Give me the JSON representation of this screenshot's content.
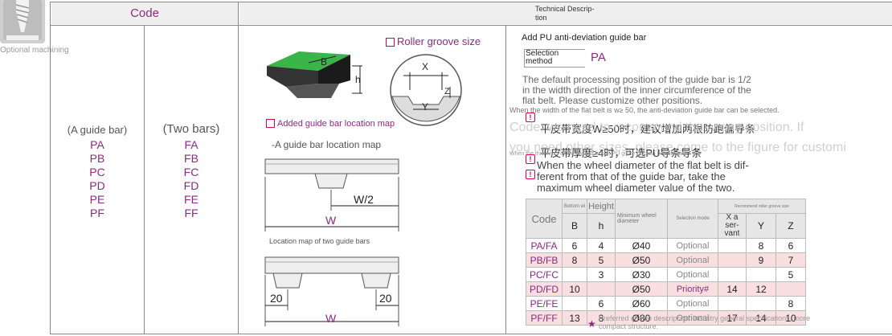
{
  "sidebar": {
    "label": "Optional machining"
  },
  "header": {
    "code": "Code",
    "tech_line1": "Technical Descrip-",
    "tech_line2": "tion"
  },
  "col_a": {
    "title": "(A guide bar)",
    "codes": [
      "PA",
      "PB",
      "PC",
      "PD",
      "PE",
      "PF"
    ]
  },
  "col_b": {
    "title": "(Two bars)",
    "codes": [
      "FA",
      "FB",
      "FC",
      "FD",
      "FE",
      "FF"
    ]
  },
  "diagrams": {
    "roller_groove": "Roller groove size",
    "added_map": "Added guide bar location map",
    "single_map": "-A guide bar location map",
    "two_map": "Location map of two guide bars",
    "dim_B": "B",
    "dim_h": "h",
    "dim_X": "X",
    "dim_Y": "Y",
    "dim_Z": "Z",
    "dim_W2": "W/2",
    "dim_W": "W",
    "dim_20": "20"
  },
  "tech": {
    "add_title": "Add PU anti-deviation guide bar",
    "sel_line1": "Selection",
    "sel_line2": "method",
    "sel_value": "PA",
    "para1_l1": "The default processing position of the guide bar is 1/2",
    "para1_l2": "in the width direction of the inner circumference of the",
    "para1_l3": "flat belt. Please customize other positions.",
    "note_small1": "When the width of the flat belt is w≥ 50, the anti-deviation guide bar can be selected.",
    "note_cn1": "平皮带宽度W≥50时，建议增加两根防跑偏导条",
    "overlay1": "Code, we need to recommend the wrong position. If",
    "overlay2": "you need other sizes, please come to the figure for customi",
    "note_cn2": "平皮带厚度≥4时，可选PU导条导条",
    "note_small2": "When the thickness of the flat belt is ≥ 4, PU guide bar can be selected.",
    "wheel_l1": "When the wheel diameter of the flat belt is dif-",
    "wheel_l2": "ferent from that of the guide bar, take the",
    "wheel_l3": "maximum wheel diameter value of the two.",
    "footer_l1": "Preferred choice description: industry general specifications, more",
    "footer_l2": "compact structure.",
    "star": "★",
    "warn_icon": "!"
  },
  "spec_table": {
    "h_code": "Code",
    "h_bottom": "Bottom wi",
    "h_height": "Height",
    "h_minwheel_l1": "Minimum wheel",
    "h_minwheel_l2": "diameter",
    "h_selection": "Selection mode",
    "h_groove": "Recommend roller groove size",
    "h_B": "B",
    "h_h": "h",
    "h_X": "X a ser- vant",
    "h_Y": "Y",
    "h_Z": "Z",
    "rows": [
      {
        "code": "PA/FA",
        "B": "6",
        "h": "4",
        "d": "Ø40",
        "sel": "Optional",
        "X": "",
        "Y": "8",
        "Z": "6"
      },
      {
        "code": "PB/FB",
        "B": "8",
        "h": "5",
        "d": "Ø50",
        "sel": "Optional",
        "X": "",
        "Y": "9",
        "Z": "7"
      },
      {
        "code": "PC/FC",
        "B": "",
        "h": "3",
        "d": "Ø30",
        "sel": "Optional",
        "X": "",
        "Y": "",
        "Z": "5"
      },
      {
        "code": "PD/FD",
        "B": "10",
        "h": "",
        "d": "Ø50",
        "sel": "Priority#",
        "X": "14",
        "Y": "12",
        "Z": ""
      },
      {
        "code": "PE/FE",
        "B": "",
        "h": "6",
        "d": "Ø60",
        "sel": "Optional",
        "X": "",
        "Y": "",
        "Z": "8"
      },
      {
        "code": "PF/FF",
        "B": "13",
        "h": "8",
        "d": "Ø80",
        "sel": "Optional",
        "X": "17",
        "Y": "14",
        "Z": "10"
      }
    ]
  },
  "colors": {
    "accent": "#8a2a80",
    "warn": "#d1005a",
    "block_green": "#3bb54a",
    "pink_row": "#f9dfe0"
  }
}
